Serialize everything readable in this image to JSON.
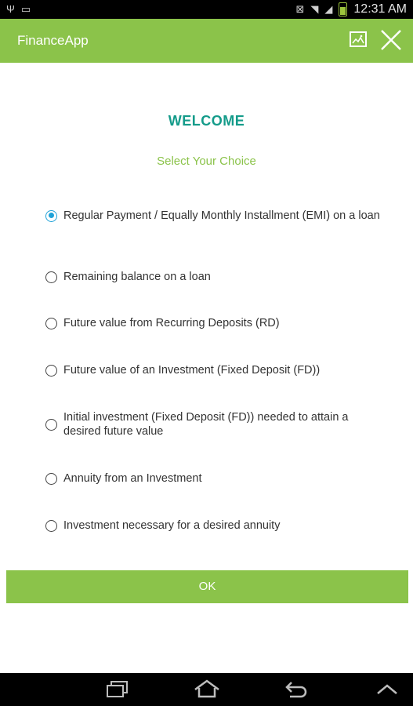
{
  "status_bar": {
    "time": "12:31 AM",
    "icons": [
      "usb-icon",
      "image-icon",
      "nfc-icon",
      "wifi-icon",
      "signal-icon",
      "battery-icon"
    ]
  },
  "app_bar": {
    "title": "FinanceApp",
    "actions": [
      "image-icon",
      "close-icon"
    ]
  },
  "main": {
    "welcome": "WELCOME",
    "subtitle": "Select Your Choice",
    "options": [
      {
        "label": "Regular Payment / Equally Monthly Installment (EMI) on a loan",
        "selected": true
      },
      {
        "label": "Remaining balance on a loan",
        "selected": false
      },
      {
        "label": "Future value from Recurring Deposits (RD)",
        "selected": false
      },
      {
        "label": "Future value of an Investment (Fixed Deposit (FD))",
        "selected": false
      },
      {
        "label": "Initial investment (Fixed Deposit (FD)) needed to attain a desired future value",
        "selected": false
      },
      {
        "label": "Annuity from an Investment",
        "selected": false
      },
      {
        "label": "Investment necessary for a desired annuity",
        "selected": false
      }
    ],
    "ok_label": "OK"
  },
  "nav_bar": {
    "buttons": [
      "recent-apps-icon",
      "home-icon",
      "back-icon",
      "menu-up-icon"
    ]
  },
  "colors": {
    "accent_green": "#8bc34a",
    "welcome_teal": "#149b8a",
    "radio_blue": "#1fa2d8"
  }
}
